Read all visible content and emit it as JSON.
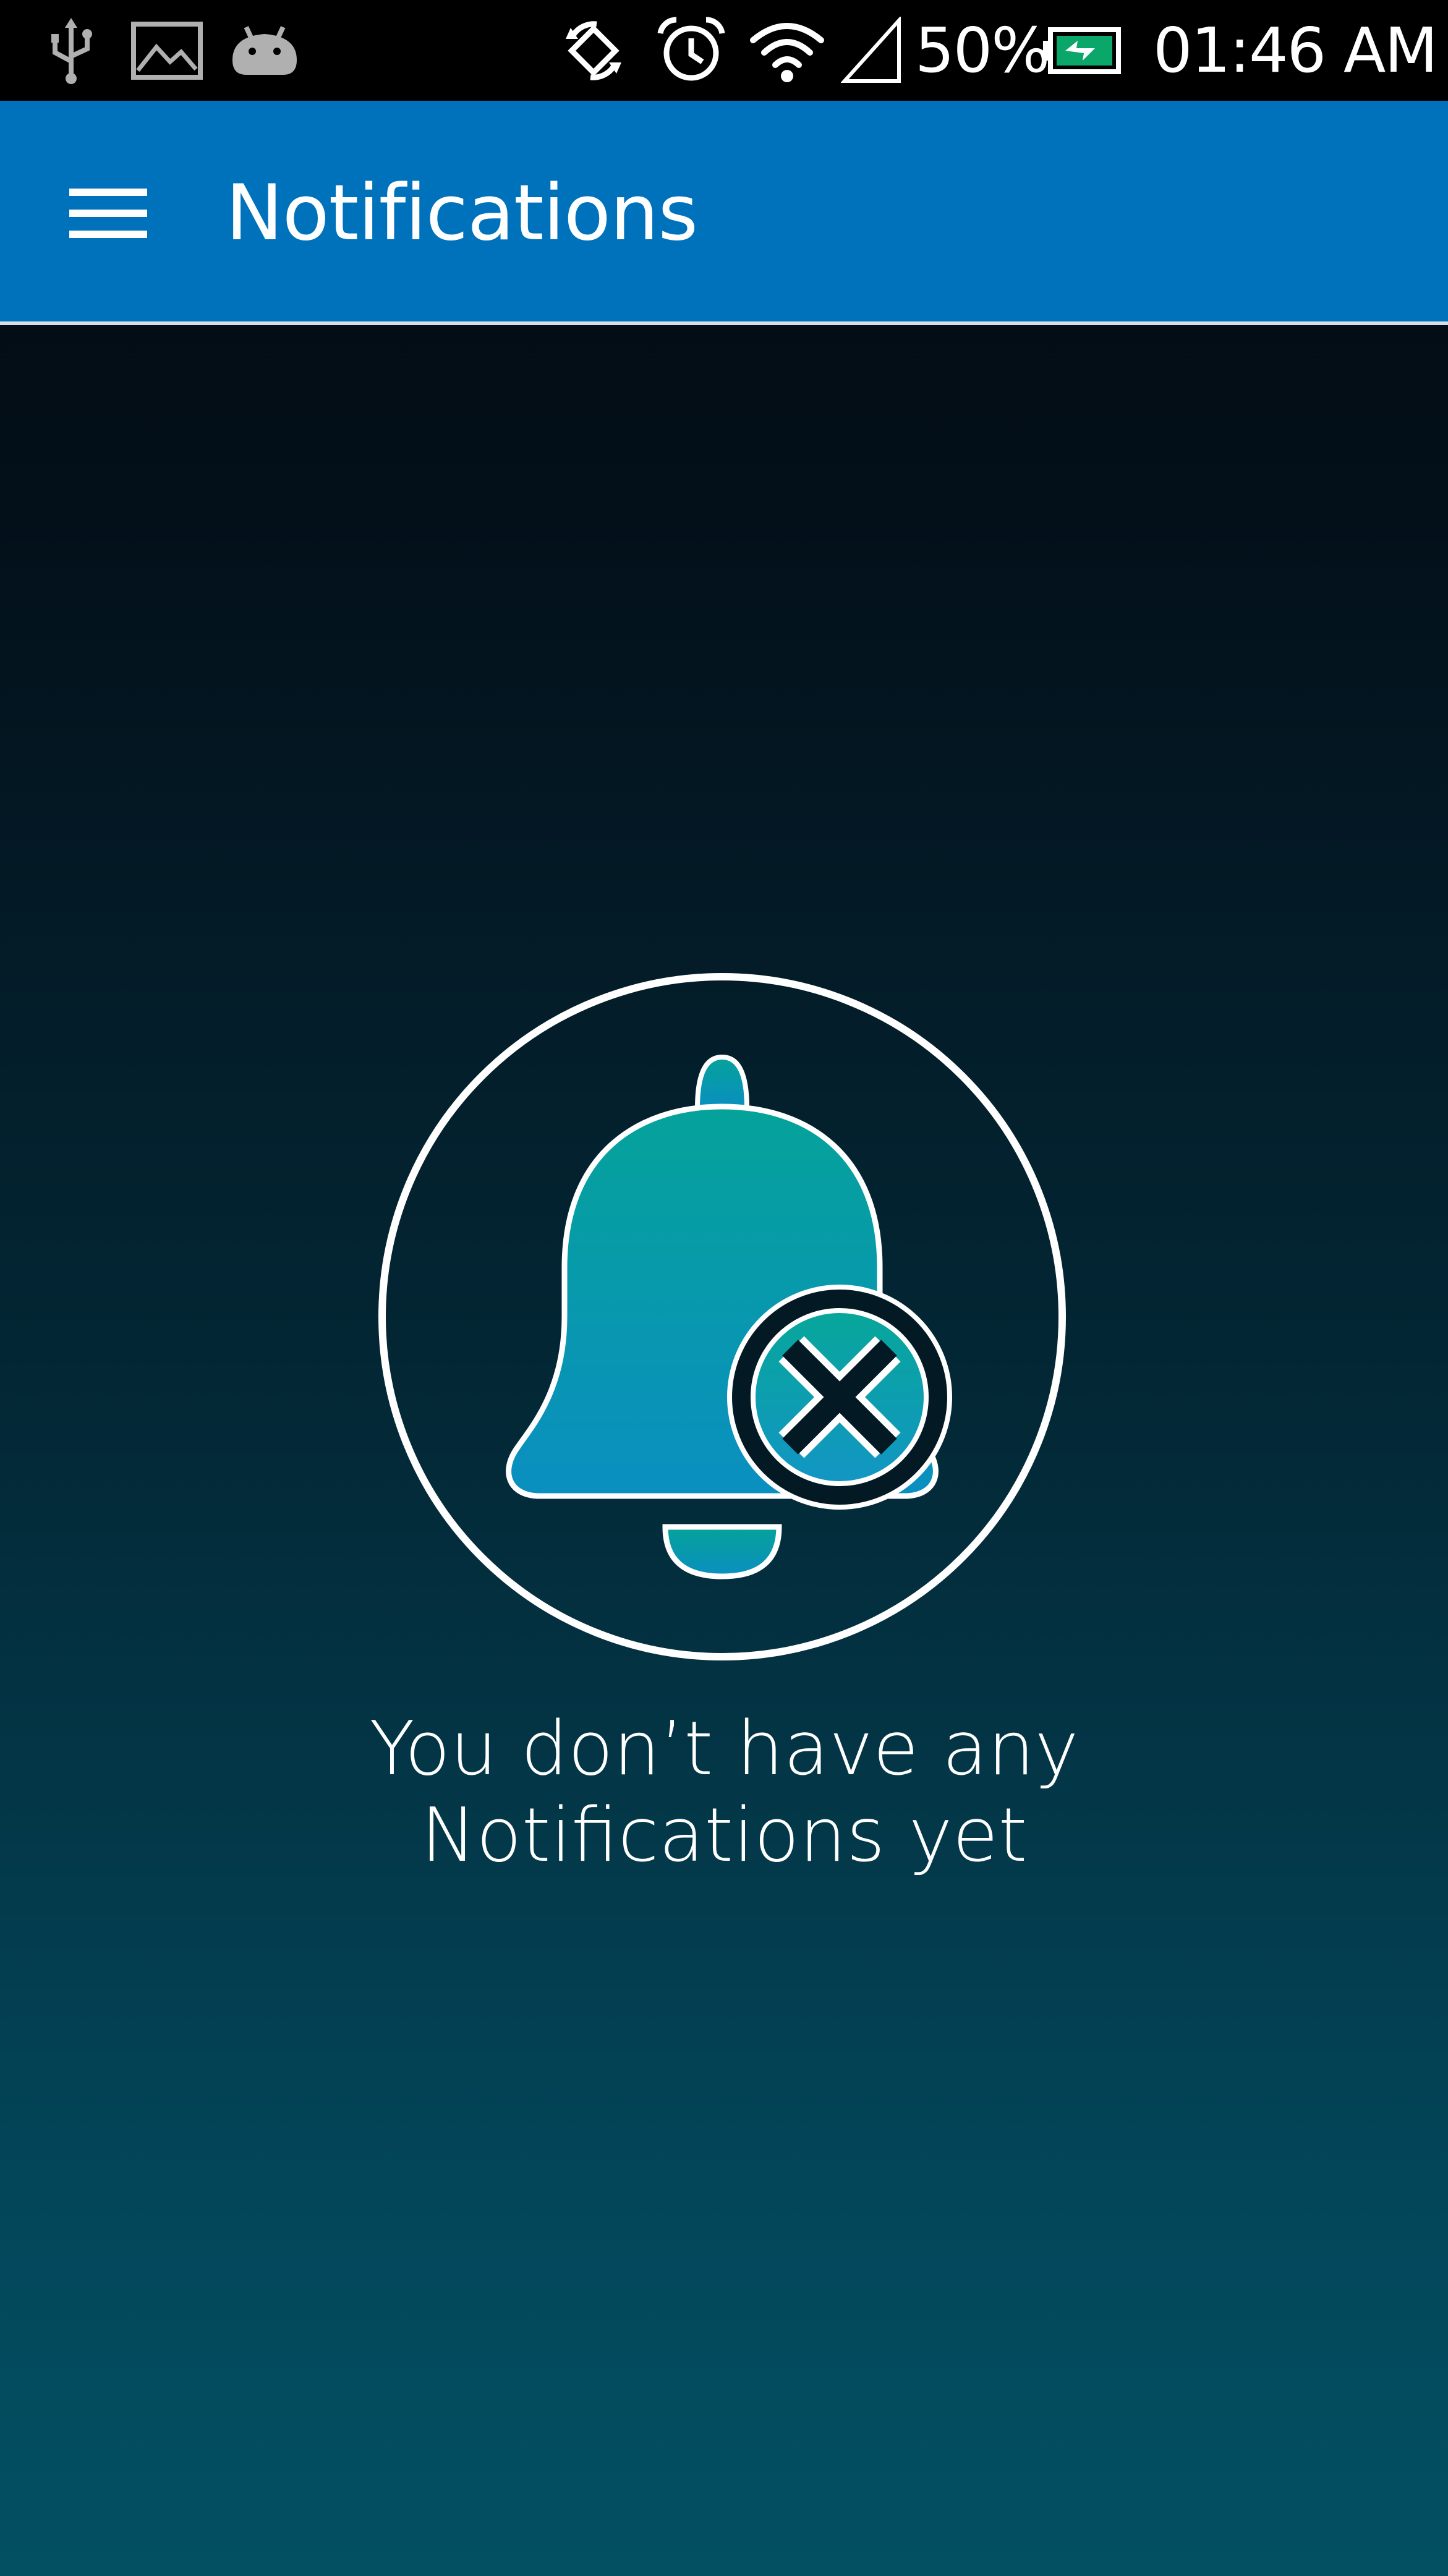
{
  "status_bar": {
    "icons": [
      "usb-icon",
      "image-icon",
      "android-icon",
      "rotate-lock-icon",
      "alarm-icon",
      "wifi-icon",
      "signal-icon",
      "battery-charging-icon"
    ],
    "battery_percent": "50%",
    "time": "01:46 AM"
  },
  "app_bar": {
    "menu_icon": "hamburger-menu-icon",
    "title": "Notifications",
    "background_color": "#0072bc"
  },
  "empty_state": {
    "icon": "bell-with-x-icon",
    "message_line1": "You don’t have any",
    "message_line2": "Notifications yet"
  },
  "colors": {
    "accent_teal": "#05a29a",
    "accent_blue": "#0a8fc0",
    "background_top": "#02080c",
    "background_bottom": "#035062"
  }
}
